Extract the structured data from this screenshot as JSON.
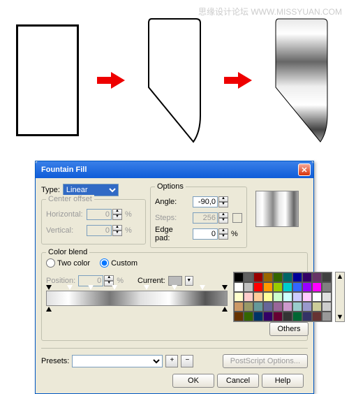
{
  "watermark": "思缘设计论坛  WWW.MISSYUAN.COM",
  "dialog": {
    "title": "Fountain Fill",
    "type_label": "Type:",
    "type_value": "Linear",
    "center_offset": {
      "title": "Center offset",
      "horizontal_label": "Horizontal:",
      "horizontal_value": "0",
      "vertical_label": "Vertical:",
      "vertical_value": "0",
      "pct": "%"
    },
    "options": {
      "title": "Options",
      "angle_label": "Angle:",
      "angle_value": "-90,0",
      "steps_label": "Steps:",
      "steps_value": "256",
      "edgepad_label": "Edge pad:",
      "edgepad_value": "0",
      "pct": "%"
    },
    "colorblend": {
      "title": "Color blend",
      "two_color": "Two color",
      "custom": "Custom",
      "position_label": "Position:",
      "position_value": "0",
      "pct": "%",
      "current_label": "Current:",
      "others_btn": "Others"
    },
    "presets_label": "Presets:",
    "postscript_btn": "PostScript Options...",
    "ok": "OK",
    "cancel": "Cancel",
    "help": "Help"
  },
  "palette_colors": [
    "#000",
    "#606060",
    "#900",
    "#960",
    "#360",
    "#066",
    "#009",
    "#306",
    "#636",
    "#404040",
    "#fff",
    "#c0c0c0",
    "#f00",
    "#f90",
    "#9c0",
    "#0cc",
    "#36f",
    "#90f",
    "#f0f",
    "#808080",
    "#ffc",
    "#fcc",
    "#fc9",
    "#ff9",
    "#cfc",
    "#cff",
    "#ccf",
    "#fcf",
    "#fff",
    "#e0e0e0",
    "#c96",
    "#996",
    "#699",
    "#669",
    "#969",
    "#c9c",
    "#9cc",
    "#99c",
    "#cc9",
    "#ccc",
    "#630",
    "#360",
    "#036",
    "#306",
    "#603",
    "#333",
    "#063",
    "#336",
    "#633",
    "#999"
  ]
}
